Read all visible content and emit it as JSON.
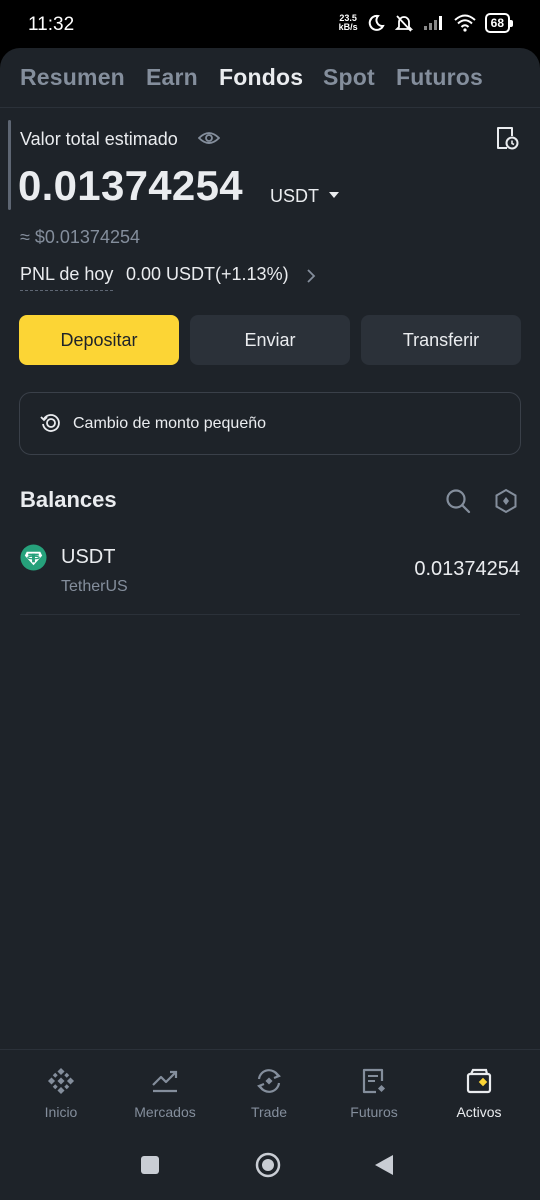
{
  "status_bar": {
    "time": "11:32",
    "net_speed_value": "23.5",
    "net_speed_unit": "kB/s",
    "battery": "68"
  },
  "tabs": [
    {
      "label": "Resumen",
      "active": false
    },
    {
      "label": "Earn",
      "active": false
    },
    {
      "label": "Fondos",
      "active": true
    },
    {
      "label": "Spot",
      "active": false
    },
    {
      "label": "Futuros",
      "active": false
    }
  ],
  "summary": {
    "label": "Valor total estimado",
    "amount": "0.01374254",
    "currency": "USDT",
    "usd_approx": "≈ $0.01374254",
    "pnl_label": "PNL de hoy",
    "pnl_value": "0.00 USDT(+1.13%)"
  },
  "actions": {
    "deposit": "Depositar",
    "send": "Enviar",
    "transfer": "Transferir"
  },
  "small_change": {
    "label": "Cambio de monto pequeño"
  },
  "balances": {
    "title": "Balances",
    "items": [
      {
        "symbol": "USDT",
        "name": "TetherUS",
        "amount": "0.01374254",
        "icon": "tether-logo-icon"
      }
    ]
  },
  "bottom_nav": [
    {
      "label": "Inicio",
      "icon": "binance-logo-icon",
      "active": false
    },
    {
      "label": "Mercados",
      "icon": "chart-trend-icon",
      "active": false
    },
    {
      "label": "Trade",
      "icon": "trade-swap-icon",
      "active": false
    },
    {
      "label": "Futuros",
      "icon": "futures-doc-icon",
      "active": false
    },
    {
      "label": "Activos",
      "icon": "wallet-icon",
      "active": true
    }
  ],
  "colors": {
    "background": "#1E2329",
    "accent": "#FCD535",
    "button_secondary": "#2B3139",
    "text_primary": "#EAECEF",
    "text_secondary": "#848E9C",
    "tether": "#26A17B"
  }
}
